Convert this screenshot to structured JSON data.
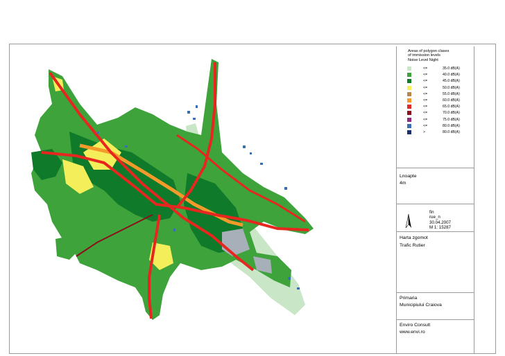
{
  "legend": {
    "title_lines": [
      "Areas of polygon clases",
      "of immission levels",
      "Noise Level Night"
    ],
    "classes": [
      {
        "operator": "<=",
        "value": "35.0 dB(A)",
        "color": "#c9e6c6"
      },
      {
        "operator": "<=",
        "value": "40.0 dB(A)",
        "color": "#3ea33a"
      },
      {
        "operator": "<=",
        "value": "45.0 dB(A)",
        "color": "#0f7a2a"
      },
      {
        "operator": "<=",
        "value": "50.0 dB(A)",
        "color": "#f4ee5a"
      },
      {
        "operator": "<=",
        "value": "55.0 dB(A)",
        "color": "#b7864a"
      },
      {
        "operator": "<=",
        "value": "60.0 dB(A)",
        "color": "#f39a2a"
      },
      {
        "operator": "<=",
        "value": "65.0 dB(A)",
        "color": "#e5271f"
      },
      {
        "operator": "<=",
        "value": "70.0 dB(A)",
        "color": "#8b0f1c"
      },
      {
        "operator": "<=",
        "value": "75.0 dB(A)",
        "color": "#8e2b7a"
      },
      {
        "operator": "<=",
        "value": "80.0 dB(A)",
        "color": "#3a6db4"
      },
      {
        "operator": ">",
        "value": "80.0 dB(A)",
        "color": "#1a2f6e"
      }
    ]
  },
  "level_info": {
    "indicator": "Lnoapte",
    "height": "4m"
  },
  "scale_info": {
    "code": "fin",
    "layer": "rue_n",
    "date": "30.04.2007",
    "scale": "M 1:  15287"
  },
  "map_title": {
    "line1": "Harta zgomot",
    "line2": "Trafic Rutier"
  },
  "client": {
    "line1": "Primaria",
    "line2": "Municipiului Craiova"
  },
  "author": {
    "line1": "Enviro Consult",
    "line2": "www.envi.ro"
  },
  "map_colors": {
    "low": "#c9e6c6",
    "green": "#3ea33a",
    "dark_green": "#0f7a2a",
    "yellow": "#f4ee5a",
    "orange": "#f39a2a",
    "red": "#e5271f",
    "dark_red": "#8b0f1c",
    "blue": "#3a6db4",
    "grey": "#a7b0b8"
  }
}
